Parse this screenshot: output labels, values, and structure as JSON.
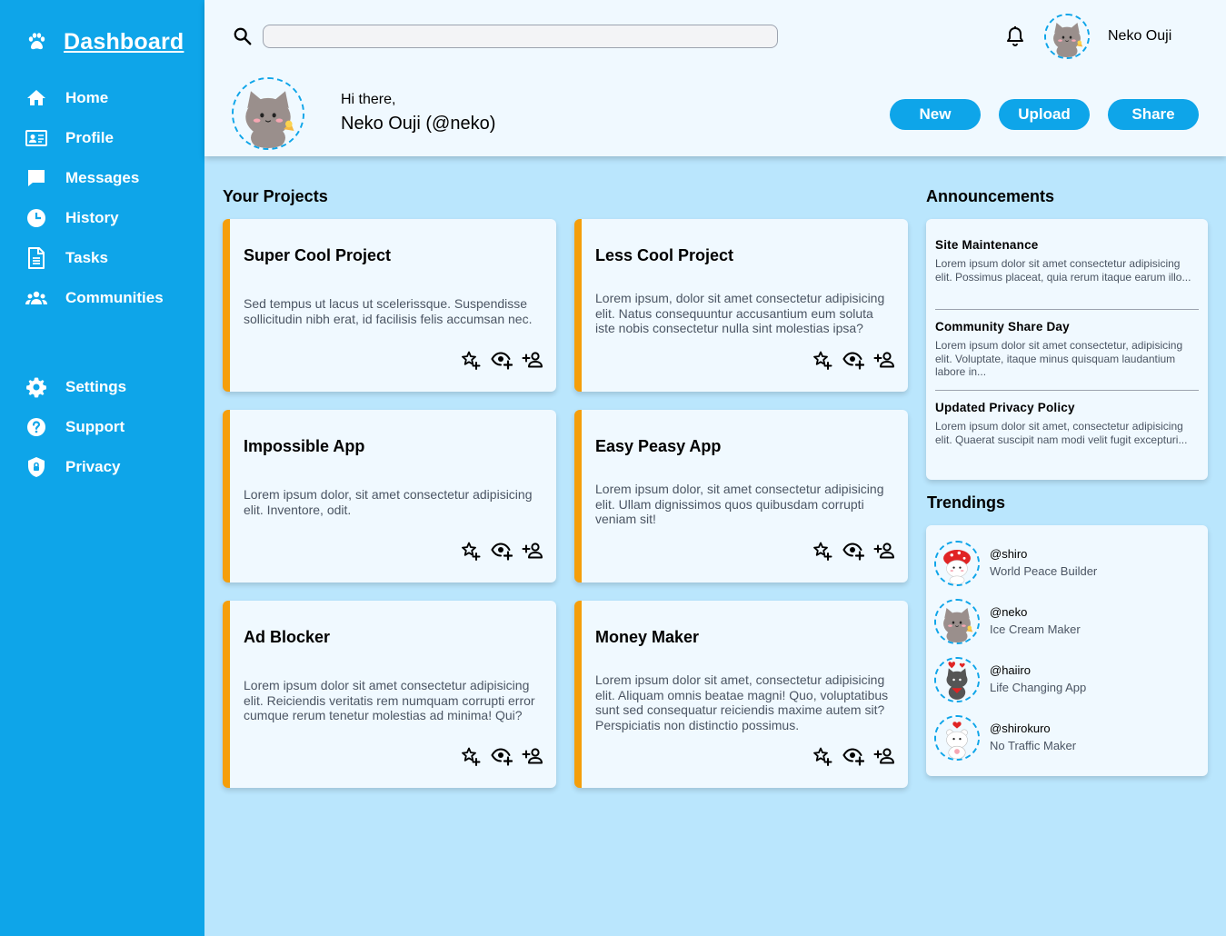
{
  "sidebar": {
    "brand": "Dashboard",
    "items": [
      {
        "label": "Home",
        "icon": "home-icon"
      },
      {
        "label": "Profile",
        "icon": "id-card-icon"
      },
      {
        "label": "Messages",
        "icon": "message-icon"
      },
      {
        "label": "History",
        "icon": "clock-icon"
      },
      {
        "label": "Tasks",
        "icon": "document-icon"
      },
      {
        "label": "Communities",
        "icon": "people-icon"
      },
      {
        "label": "Settings",
        "icon": "gear-icon"
      },
      {
        "label": "Support",
        "icon": "help-icon"
      },
      {
        "label": "Privacy",
        "icon": "shield-icon"
      }
    ]
  },
  "header": {
    "search_value": "",
    "username": "Neko Ouji",
    "greeting": "Hi there,",
    "fullname": "Neko Ouji (@neko)",
    "buttons": {
      "new": "New",
      "upload": "Upload",
      "share": "Share"
    }
  },
  "projects": {
    "title": "Your Projects",
    "cards": [
      {
        "title": "Super Cool Project",
        "desc": "Sed tempus ut lacus ut scelerissque. Suspendisse sollicitudin nibh erat, id facilisis felis accumsan nec."
      },
      {
        "title": "Less Cool Project",
        "desc": "Lorem ipsum, dolor sit amet consectetur adipisicing elit. Natus consequuntur accusantium eum soluta iste nobis consectetur nulla sint molestias ipsa?"
      },
      {
        "title": "Impossible App",
        "desc": "Lorem ipsum dolor, sit amet consectetur adipisicing elit. Inventore, odit."
      },
      {
        "title": "Easy Peasy App",
        "desc": "Lorem ipsum dolor, sit amet consectetur adipisicing elit. Ullam dignissimos quos quibusdam corrupti veniam sit!"
      },
      {
        "title": "Ad Blocker",
        "desc": "Lorem ipsum dolor sit amet consectetur adipisicing elit. Reiciendis veritatis rem numquam corrupti error cumque rerum tenetur molestias ad minima! Qui?"
      },
      {
        "title": "Money Maker",
        "desc": "Lorem ipsum dolor sit amet, consectetur adipisicing elit. Aliquam omnis beatae magni! Quo, voluptatibus sunt sed consequatur reiciendis maxime autem sit? Perspiciatis non distinctio possimus."
      }
    ]
  },
  "announcements": {
    "title": "Announcements",
    "items": [
      {
        "title": "Site Maintenance",
        "text": "Lorem ipsum dolor sit amet consectetur adipisicing elit. Possimus placeat, quia rerum itaque earum illo..."
      },
      {
        "title": "Community Share Day",
        "text": "Lorem ipsum dolor sit amet consectetur, adipisicing elit. Voluptate, itaque minus quisquam laudantium labore in..."
      },
      {
        "title": "Updated Privacy Policy",
        "text": "Lorem ipsum dolor sit amet, consectetur adipisicing elit. Quaerat suscipit nam modi velit fugit excepturi..."
      }
    ]
  },
  "trendings": {
    "title": "Trendings",
    "items": [
      {
        "handle": "@shiro",
        "subtitle": "World Peace Builder"
      },
      {
        "handle": "@neko",
        "subtitle": "Ice Cream Maker"
      },
      {
        "handle": "@haiiro",
        "subtitle": "Life Changing App"
      },
      {
        "handle": "@shirokuro",
        "subtitle": "No Traffic Maker"
      }
    ]
  },
  "colors": {
    "sidebar": "#0ea5e9",
    "background": "#bae6fd",
    "panel": "#f0f9ff",
    "card_accent": "#f59e0b"
  }
}
